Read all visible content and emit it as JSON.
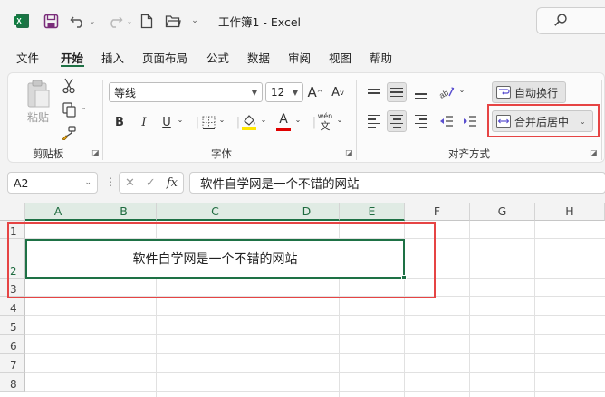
{
  "titlebar": {
    "title": "工作簿1  -  Excel",
    "icons": [
      "excel-logo",
      "save",
      "undo",
      "redo",
      "new-file",
      "open-folder"
    ],
    "search_icon": "search-icon"
  },
  "menu": {
    "items": [
      "文件",
      "开始",
      "插入",
      "页面布局",
      "公式",
      "数据",
      "审阅",
      "视图",
      "帮助"
    ],
    "active": "开始"
  },
  "ribbon": {
    "clipboard": {
      "paste": "粘贴",
      "group": "剪贴板"
    },
    "font": {
      "name": "等线",
      "size": "12",
      "grow": "A",
      "shrink": "A",
      "bold": "B",
      "italic": "I",
      "underline": "U",
      "phonetic_top": "wén",
      "phonetic_bottom": "文",
      "group": "字体",
      "font_color": "#e00000",
      "fill_color": "#ffe600"
    },
    "alignment": {
      "wrap_text": "自动换行",
      "merge_center": "合并后居中",
      "group": "对齐方式"
    }
  },
  "formula_bar": {
    "name_box": "A2",
    "fx": "fx",
    "content": "软件自学网是一个不错的网站"
  },
  "grid": {
    "columns": [
      "A",
      "B",
      "C",
      "D",
      "E",
      "F",
      "G",
      "H"
    ],
    "rows": [
      "1",
      "2",
      "3",
      "4",
      "5",
      "6",
      "7",
      "8"
    ],
    "merged_cell_text": "软件自学网是一个不错的网站"
  },
  "colors": {
    "accent": "#1e7145",
    "annotation": "#e64444"
  }
}
